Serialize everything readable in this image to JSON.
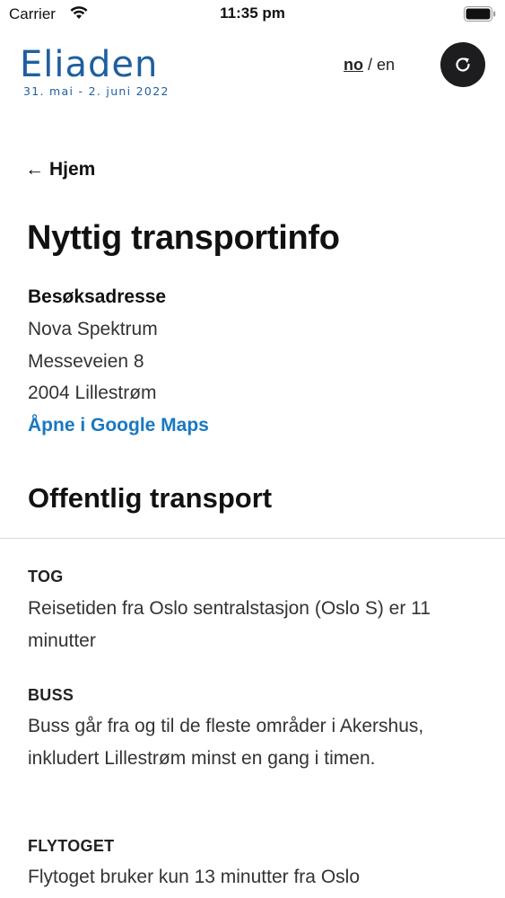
{
  "status_bar": {
    "carrier": "Carrier",
    "time": "11:35 pm",
    "wifi_icon": "wifi-icon",
    "battery_icon": "battery-icon"
  },
  "header": {
    "logo_title": "Eliaden",
    "logo_subtitle": "31. mai - 2. juni 2022",
    "lang_no": "no",
    "lang_sep": " / ",
    "lang_en": "en",
    "refresh_icon": "refresh-icon",
    "brand_color": "#1f5f9f"
  },
  "nav": {
    "back_arrow": "←",
    "back_label": "Hjem"
  },
  "page": {
    "title": "Nyttig transportinfo",
    "address": {
      "heading": "Besøksadresse",
      "lines": [
        "Nova Spektrum",
        "Messeveien 8",
        "2004 Lillestrøm"
      ],
      "maps_link": "Åpne i Google Maps",
      "link_color": "#1878c2"
    },
    "public_transport": {
      "title": "Offentlig transport",
      "items": [
        {
          "label": "TOG",
          "text": "Reisetiden fra Oslo sentralstasjon (Oslo S) er 11 minutter"
        },
        {
          "label": "BUSS",
          "text": "Buss går fra og til de fleste områder i Akershus, inkludert Lillestrøm minst en gang i timen."
        },
        {
          "label": "FLYTOGET",
          "text": "Flytoget bruker kun 13 minutter fra Oslo"
        }
      ]
    }
  }
}
